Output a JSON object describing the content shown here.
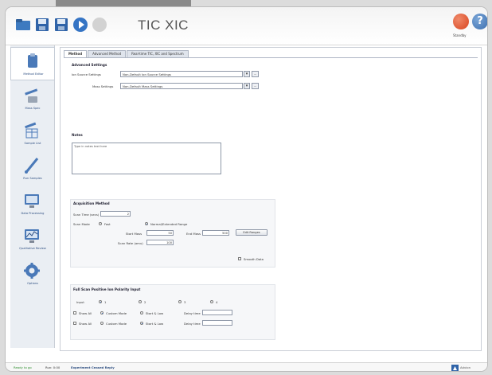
{
  "app": {
    "title": "TIC XIC"
  },
  "header": {
    "power_label": "Standby",
    "help_glyph": "?"
  },
  "sidebar": {
    "items": [
      {
        "label": "Method Editor",
        "icon": "clipboard-icon"
      },
      {
        "label": "Mass Spec",
        "icon": "mass-spec-icon"
      },
      {
        "label": "Sample List",
        "icon": "sample-list-icon"
      },
      {
        "label": "Run Samples",
        "icon": "pipette-icon"
      },
      {
        "label": "Data Processing",
        "icon": "monitor-icon"
      },
      {
        "label": "Qualitative Review",
        "icon": "chart-monitor-icon"
      },
      {
        "label": "Options",
        "icon": "gear-icon"
      }
    ]
  },
  "tabs": [
    {
      "label": "Method"
    },
    {
      "label": "Advanced Method"
    },
    {
      "label": "Real-time TIC, XIC and Spectrum"
    }
  ],
  "advanced_settings": {
    "title": "Advanced Settings",
    "row1_label": "Ion Source Settings",
    "row1_value": "Non-Default Ion Source Settings",
    "row2_label": "Mass Settings",
    "row2_value": "Non-Default Mass Settings",
    "ellipsis": "..."
  },
  "notes": {
    "title": "Notes",
    "placeholder": "Type in notes text here"
  },
  "acquisition": {
    "title": "Acquisition Method",
    "scan_time_label": "Scan Time (secs)",
    "scan_time_value": "2",
    "scan_mode_label": "Scan Mode",
    "option_fast": "Fast",
    "option_normal": "Normal/Extended Range",
    "start_mass_label": "Start Mass",
    "start_mass_value": "50",
    "end_mass_label": "End Mass",
    "end_mass_value": "500",
    "edit_ranges_label": "Edit Ranges",
    "scan_rate_label": "Scan Rate (amu)",
    "scan_rate_value": "100",
    "smooth_data_label": "Smooth Data"
  },
  "full_scan": {
    "title": "Full Scan Positive Ion Polarity Input",
    "input_label": "Input",
    "channels": [
      "1",
      "2",
      "3",
      "4"
    ],
    "row1": {
      "check_label": "Show All",
      "opt1": "Custom Mode",
      "opt2": "Start & Low",
      "field_label": "Delay time"
    },
    "row2": {
      "check_label": "Show All",
      "opt1": "Custom Mode",
      "opt2": "Start & Low",
      "field_label": "Delay time"
    }
  },
  "status": {
    "ready": "Ready to go",
    "run": "Run: 0:00",
    "warning": "Experiment Ceased Reply",
    "brand": "Advion"
  },
  "colors": {
    "accent": "#2c4d80",
    "power": "#d8441f",
    "help": "#3d6fae",
    "ready": "#2f8f2f"
  }
}
